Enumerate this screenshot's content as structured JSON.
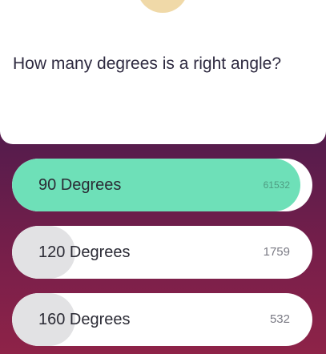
{
  "question": {
    "text": "How many degrees is a right angle?"
  },
  "answers": [
    {
      "label": "90 Degrees",
      "count": "61532",
      "share": 0.96,
      "correct": true
    },
    {
      "label": "120 Degrees",
      "count": "1759",
      "share": 0.21,
      "correct": false
    },
    {
      "label": "160 Degrees",
      "count": "532",
      "share": 0.21,
      "correct": false
    }
  ],
  "colors": {
    "correct": "#6ee0b8",
    "neutral_fill": "#e2e2e4",
    "background_top": "#3a1a55",
    "background_bottom": "#8e2348"
  },
  "icons": {
    "badge": "trivia-badge-icon"
  }
}
